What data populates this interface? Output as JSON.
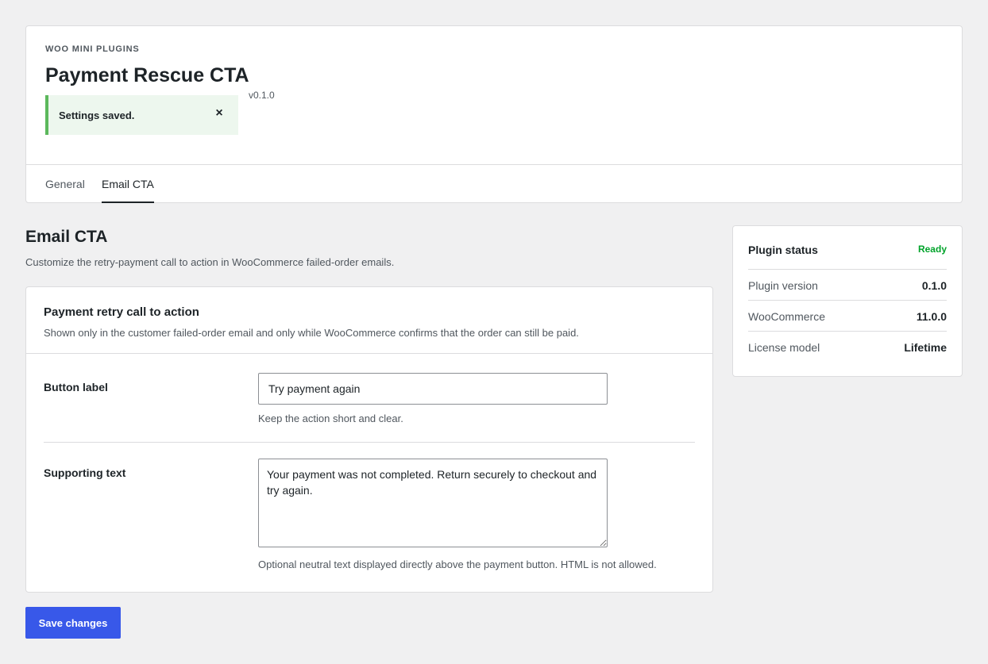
{
  "header": {
    "eyebrow": "WOO MINI PLUGINS",
    "title": "Payment Rescue CTA",
    "version": "v0.1.0",
    "notice": {
      "text": "Settings saved.",
      "close_icon": "×"
    },
    "tabs": [
      {
        "label": "General",
        "active": false
      },
      {
        "label": "Email CTA",
        "active": true
      }
    ]
  },
  "section": {
    "title": "Email CTA",
    "description": "Customize the retry-payment call to action in WooCommerce failed-order emails."
  },
  "card": {
    "title": "Payment retry call to action",
    "description": "Shown only in the customer failed-order email and only while WooCommerce confirms that the order can still be paid.",
    "button_label": {
      "label": "Button label",
      "value": "Try payment again",
      "help": "Keep the action short and clear."
    },
    "supporting_text": {
      "label": "Supporting text",
      "value": "Your payment was not completed. Return securely to checkout and try again.",
      "help": "Optional neutral text displayed directly above the payment button. HTML is not allowed."
    }
  },
  "save_button": "Save changes",
  "status": {
    "title": "Plugin status",
    "badge": "Ready",
    "badge_color": "#00a32a",
    "rows": [
      {
        "key": "Plugin version",
        "value": "0.1.0"
      },
      {
        "key": "WooCommerce",
        "value": "11.0.0"
      },
      {
        "key": "License model",
        "value": "Lifetime"
      }
    ]
  },
  "colors": {
    "accent": "#3858e9",
    "notice_border": "#5cb85c",
    "notice_bg": "#edf7ee"
  }
}
